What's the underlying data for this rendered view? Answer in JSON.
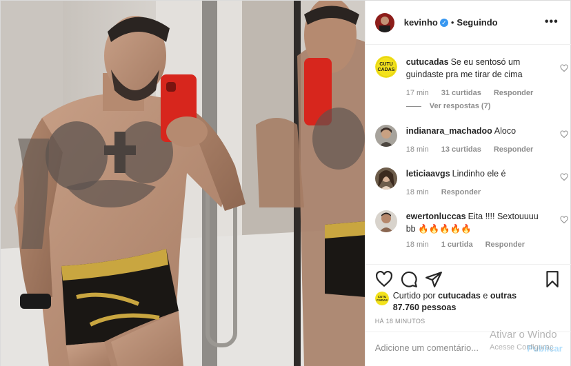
{
  "post": {
    "author": "kevinho",
    "follow_status": "Seguindo",
    "more_icon": "•••"
  },
  "comments": [
    {
      "username": "cutucadas",
      "text": "Se eu sentosó um guindaste pra me tirar de cima",
      "time": "17 min",
      "likes": "31 curtidas",
      "reply_label": "Responder",
      "view_replies": "Ver respostas (7)",
      "avatar_text": "CUTU CADAS"
    },
    {
      "username": "indianara_machadoo",
      "text": "Aloco",
      "time": "18 min",
      "likes": "13 curtidas",
      "reply_label": "Responder"
    },
    {
      "username": "leticiaavgs",
      "text": "Lindinho ele é",
      "time": "18 min",
      "reply_label": "Responder"
    },
    {
      "username": "ewertonluccas",
      "text": "Eita !!!! Sextouuuu bb 🔥🔥🔥🔥🔥",
      "time": "18 min",
      "likes": "1 curtida",
      "reply_label": "Responder"
    }
  ],
  "liked_by": {
    "prefix": "Curtido por",
    "user": "cutucadas",
    "connector": "e",
    "others": "outras 87.760 pessoas"
  },
  "timestamp": "HÁ 18 MINUTOS",
  "add_comment": {
    "placeholder": "Adicione um comentário...",
    "publish_label": "Publicar"
  },
  "windows_watermark": {
    "line1": "Ativar o Windo",
    "line2": "Acesse Configuraç"
  },
  "icons": {
    "like": "heart-icon",
    "comment": "comment-icon",
    "share": "paper-plane-icon",
    "save": "bookmark-icon",
    "verified": "verified-badge-icon"
  },
  "colors": {
    "verified_blue": "#3897f0",
    "publish_disabled": "#b2dffc",
    "meta_gray": "#8e8e8e"
  }
}
